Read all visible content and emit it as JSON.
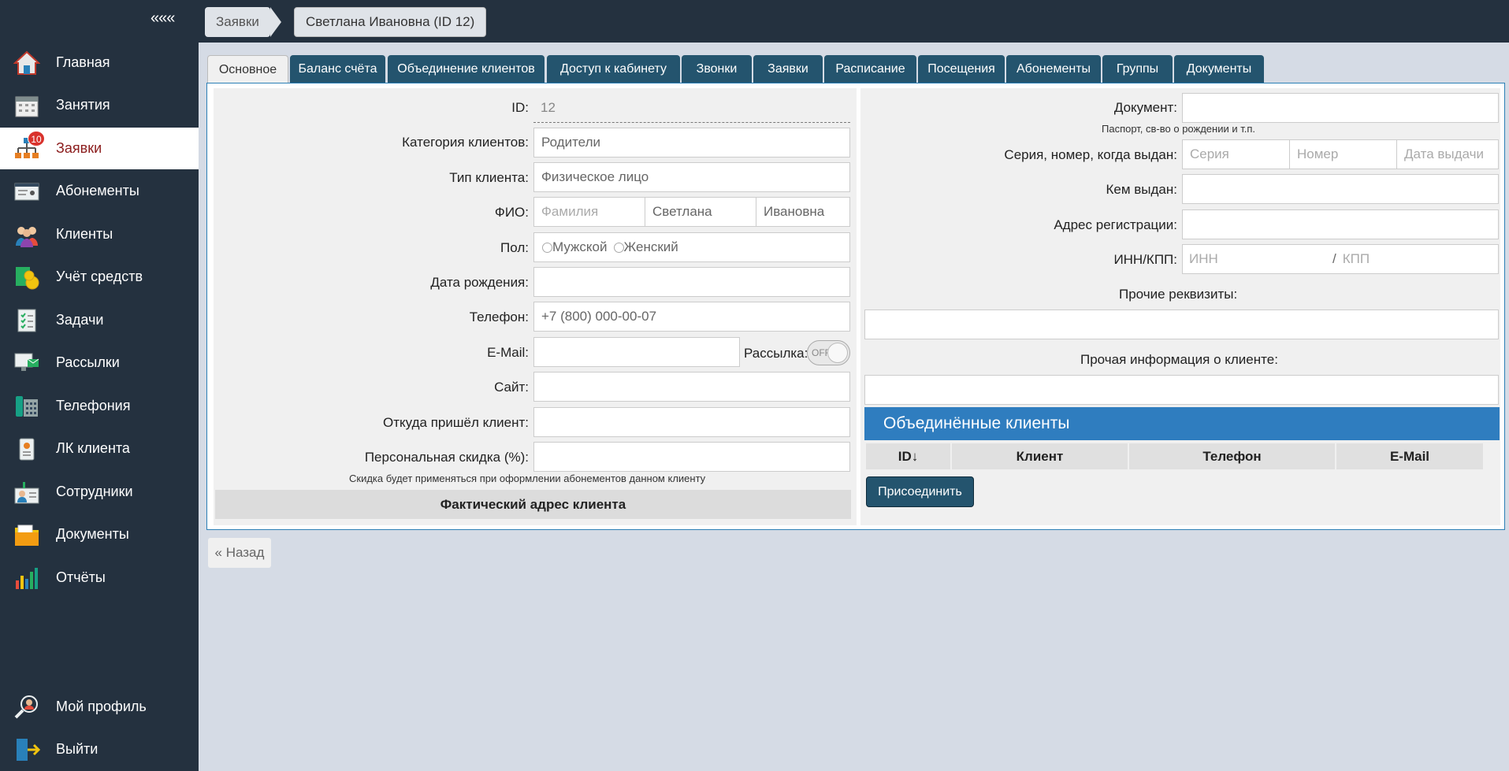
{
  "sidebar": {
    "collapse": "«««",
    "items": [
      {
        "label": "Главная"
      },
      {
        "label": "Занятия"
      },
      {
        "label": "Заявки",
        "badge": "10"
      },
      {
        "label": "Абонементы"
      },
      {
        "label": "Клиенты"
      },
      {
        "label": "Учёт средств"
      },
      {
        "label": "Задачи"
      },
      {
        "label": "Рассылки"
      },
      {
        "label": "Телефония"
      },
      {
        "label": "ЛК клиента"
      },
      {
        "label": "Сотрудники"
      },
      {
        "label": "Документы"
      },
      {
        "label": "Отчёты"
      }
    ],
    "profile": "Мой профиль",
    "logout": "Выйти"
  },
  "breadcrumb": {
    "first": "Заявки",
    "second": "Светлана Ивановна (ID 12)"
  },
  "tabs": [
    "Основное",
    "Баланс счёта",
    "Объединение клиентов",
    "Доступ к кабинету",
    "Звонки",
    "Заявки",
    "Расписание",
    "Посещения",
    "Абонементы",
    "Группы",
    "Документы"
  ],
  "left": {
    "id_label": "ID:",
    "id_value": "12",
    "category_label": "Категория клиентов:",
    "category_value": "Родители",
    "type_label": "Тип клиента:",
    "type_value": "Физическое лицо",
    "fio_label": "ФИО:",
    "fio_surname_ph": "Фамилия",
    "fio_name": "Светлана",
    "fio_patronymic": "Ивановна",
    "gender_label": "Пол:",
    "gender_male": "Мужской",
    "gender_female": "Женский",
    "birth_label": "Дата рождения:",
    "phone_label": "Телефон:",
    "phone_value": "+7 (800) 000-00-07",
    "email_label": "E-Mail:",
    "mailing_label": "Рассылка:",
    "mailing_state": "OFF",
    "site_label": "Сайт:",
    "source_label": "Откуда пришёл клиент:",
    "discount_label": "Персональная скидка (%):",
    "discount_hint": "Скидка будет применяться при оформлении абонементов данном клиенту",
    "address_section": "Фактический адрес клиента"
  },
  "right": {
    "doc_label": "Документ:",
    "doc_hint": "Паспорт, св-во о рождении и т.п.",
    "series_label": "Серия, номер, когда выдан:",
    "series_ph": "Серия",
    "number_ph": "Номер",
    "date_ph": "Дата выдачи",
    "issued_label": "Кем выдан:",
    "reg_label": "Адрес регистрации:",
    "inn_label": "ИНН/КПП:",
    "inn_ph": "ИНН",
    "inn_sep": "/",
    "kpp_ph": "КПП",
    "other_req_label": "Прочие реквизиты:",
    "other_info_label": "Прочая информация о клиенте:",
    "merged_title": "Объединённые клиенты",
    "columns": [
      "ID↓",
      "Клиент",
      "Телефон",
      "E-Mail"
    ],
    "join_button": "Присоединить"
  },
  "back_button": "« Назад"
}
